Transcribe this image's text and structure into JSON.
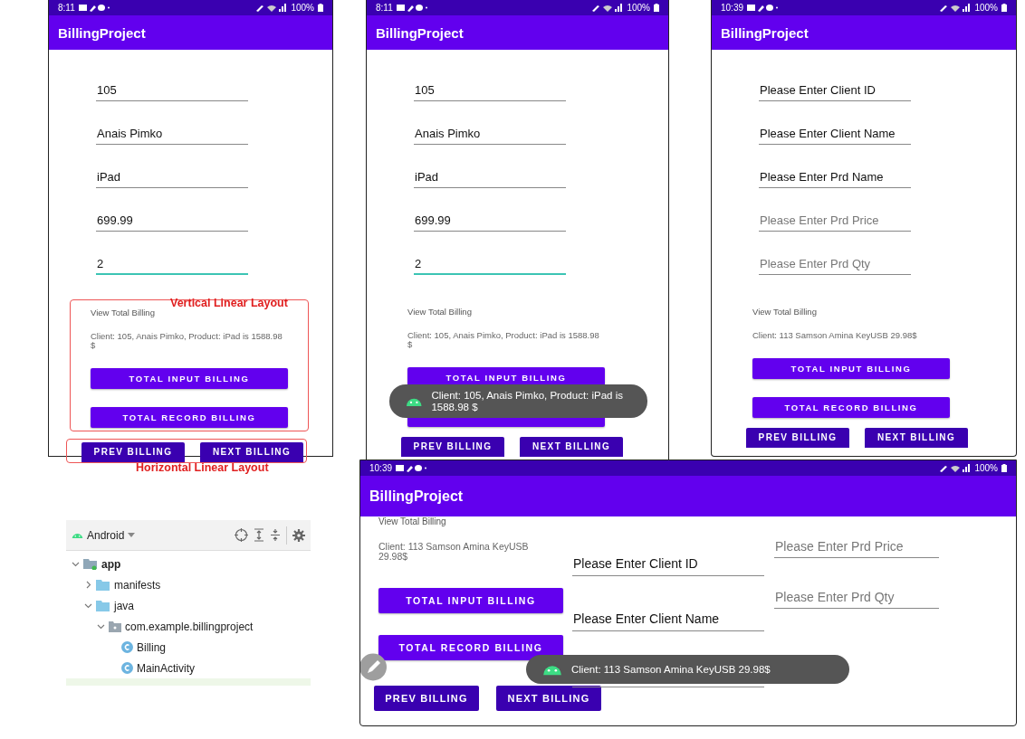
{
  "phones": [
    {
      "status": {
        "time": "8:11",
        "battery": "100%"
      },
      "app_title": "BillingProject",
      "fields": [
        {
          "value": "105",
          "focused": false
        },
        {
          "value": "Anais Pimko",
          "focused": false
        },
        {
          "value": "iPad",
          "focused": false
        },
        {
          "value": "699.99",
          "focused": false
        },
        {
          "value": "2",
          "focused": true
        }
      ],
      "result_heading": "View Total Billing",
      "result": "Client: 105, Anais Pimko, Product: iPad is 1588.98 $",
      "buttons": [
        {
          "label": "TOTAL INPUT BILLING",
          "kind": "wide"
        },
        {
          "label": "TOTAL RECORD BILLING",
          "kind": "wide"
        },
        {
          "label": "PREV BILLING",
          "kind": "nav"
        },
        {
          "label": "NEXT BILLING",
          "kind": "nav"
        }
      ],
      "annotations": [
        {
          "label": "Vertical Linear Layout",
          "kind": "vertical"
        },
        {
          "label": "Horizontal Linear Layout",
          "kind": "horizontal"
        }
      ]
    },
    {
      "status": {
        "time": "8:11",
        "battery": "100%"
      },
      "app_title": "BillingProject",
      "fields": [
        {
          "value": "105",
          "focused": false
        },
        {
          "value": "Anais Pimko",
          "focused": false
        },
        {
          "value": "iPad",
          "focused": false
        },
        {
          "value": "699.99",
          "focused": false
        },
        {
          "value": "2",
          "focused": true
        }
      ],
      "result_heading": "View Total Billing",
      "result": "Client: 105, Anais Pimko, Product: iPad is 1588.98 $",
      "buttons": [
        {
          "label": "TOTAL INPUT BILLING",
          "kind": "wide"
        },
        {
          "kind": "wide"
        },
        {
          "label": "PREV BILLING",
          "kind": "nav"
        },
        {
          "label": "NEXT BILLING",
          "kind": "nav"
        }
      ],
      "toast": {
        "text": "Client: 105, Anais Pimko, Product: iPad is 1588.98 $"
      }
    },
    {
      "status": {
        "time": "10:39",
        "battery": "100%"
      },
      "app_title": "BillingProject",
      "fields": [
        {
          "value": "Please Enter Client ID",
          "focused": false
        },
        {
          "value": "Please Enter Client Name",
          "focused": false
        },
        {
          "value": "Please Enter Prd Name",
          "focused": false
        },
        {
          "placeholder": "Please Enter Prd Price",
          "focused": false
        },
        {
          "placeholder": "Please Enter Prd Qty",
          "focused": false
        }
      ],
      "result_heading": "View Total Billing",
      "result": "Client: 113 Samson Amina KeyUSB 29.98$",
      "buttons": [
        {
          "label": "TOTAL INPUT BILLING",
          "kind": "wide"
        },
        {
          "label": "TOTAL RECORD BILLING",
          "kind": "wide"
        },
        {
          "label": "PREV BILLING",
          "kind": "nav"
        },
        {
          "label": "NEXT BILLING",
          "kind": "nav"
        }
      ]
    }
  ],
  "project_view": {
    "selector": "Android",
    "tree": [
      {
        "label": "app",
        "kind": "module",
        "expanded": true,
        "children": [
          {
            "label": "manifests",
            "kind": "folder",
            "expanded": false
          },
          {
            "label": "java",
            "kind": "folder",
            "expanded": true,
            "children": [
              {
                "label": "com.example.billingproject",
                "kind": "package",
                "expanded": true,
                "children": [
                  {
                    "label": "Billing",
                    "kind": "class"
                  },
                  {
                    "label": "MainActivity",
                    "kind": "class"
                  }
                ]
              }
            ]
          }
        ]
      }
    ]
  },
  "landscape_phone": {
    "status": {
      "time": "10:39",
      "battery": "100%"
    },
    "app_title": "BillingProject",
    "result_heading": "View Total Billing",
    "result": "Client: 113 Samson Amina KeyUSB 29.98$",
    "buttons": [
      {
        "label": "TOTAL INPUT BILLING",
        "kind": "wide"
      },
      {
        "label": "TOTAL RECORD BILLING",
        "kind": "wide"
      },
      {
        "label": "PREV BILLING",
        "kind": "nav"
      },
      {
        "label": "NEXT BILLING",
        "kind": "nav"
      }
    ],
    "fields_middle": [
      {
        "value": "Please Enter Client ID"
      },
      {
        "value": "Please Enter Client Name"
      }
    ],
    "fields_right": [
      {
        "placeholder": "Please Enter Prd Price"
      },
      {
        "placeholder": "Please Enter Prd Qty"
      }
    ],
    "toast": {
      "text": "Client: 113 Samson Amina KeyUSB 29.98$"
    }
  }
}
